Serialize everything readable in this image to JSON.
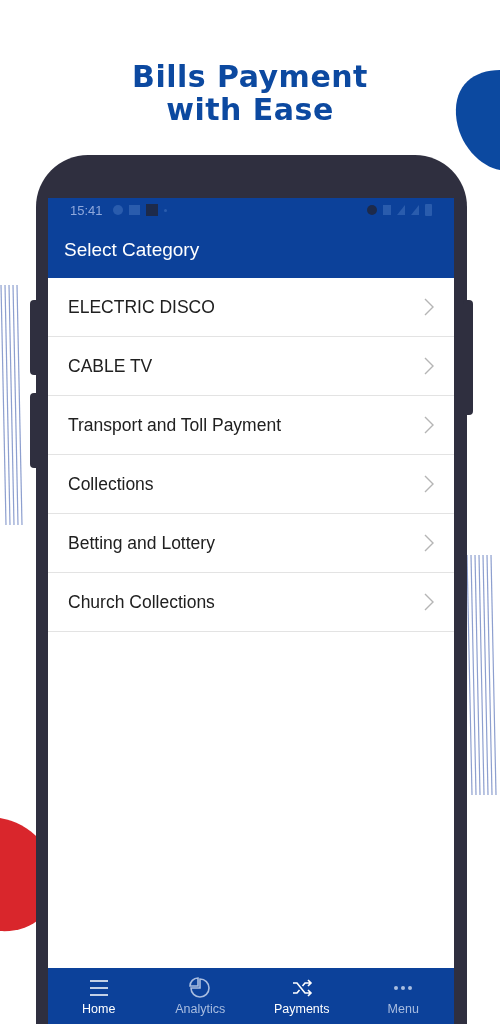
{
  "headline": {
    "line_1": "Bills Payment",
    "line_2": "with Ease"
  },
  "status_bar": {
    "time": "15:41"
  },
  "app_bar": {
    "title": "Select Category"
  },
  "categories": [
    {
      "label": "ELECTRIC DISCO"
    },
    {
      "label": "CABLE TV"
    },
    {
      "label": "Transport and Toll Payment"
    },
    {
      "label": "Collections"
    },
    {
      "label": "Betting and Lottery"
    },
    {
      "label": "Church Collections"
    }
  ],
  "bottom_nav": [
    {
      "label": "Home",
      "kind": "menu",
      "highlighted": true
    },
    {
      "label": "Analytics",
      "kind": "pie",
      "highlighted": false
    },
    {
      "label": "Payments",
      "kind": "shuffle",
      "highlighted": true
    },
    {
      "label": "Menu",
      "kind": "dots",
      "highlighted": false
    }
  ]
}
